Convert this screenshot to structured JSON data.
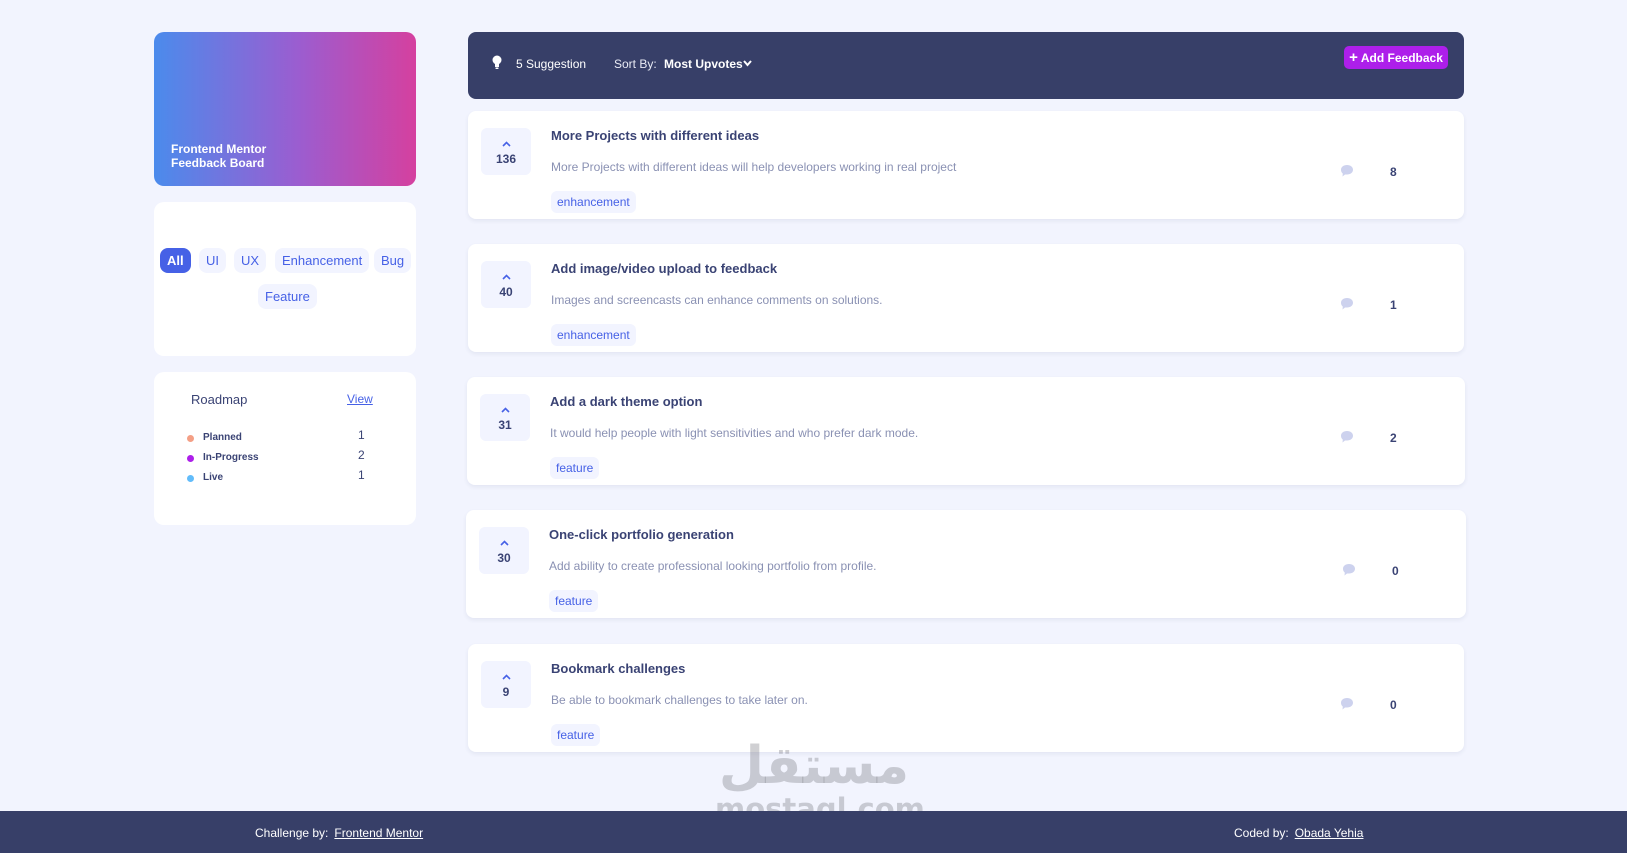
{
  "brand": {
    "line1": "Frontend Mentor",
    "line2": "Feedback Board"
  },
  "filters": [
    "All",
    "UI",
    "UX",
    "Enhancement",
    "Bug",
    "Feature"
  ],
  "roadmap": {
    "title": "Roadmap",
    "view_label": "View",
    "items": [
      {
        "label": "Planned",
        "count": "1",
        "color": "#f49f85"
      },
      {
        "label": "In-Progress",
        "count": "2",
        "color": "#ad1fea"
      },
      {
        "label": "Live",
        "count": "1",
        "color": "#62bcfa"
      }
    ]
  },
  "toolbar": {
    "suggestions": "5 Suggestion",
    "sort_label": "Sort By:",
    "sort_value": "Most Upvotes",
    "add_label": "Add Feedback"
  },
  "feedback": [
    {
      "votes": "136",
      "title": "More Projects with different ideas",
      "description": "More Projects with different ideas will help developers working in real project",
      "tag": "enhancement",
      "comments": "8"
    },
    {
      "votes": "40",
      "title": "Add image/video upload to feedback",
      "description": "Images and screencasts can enhance comments on solutions.",
      "tag": "enhancement",
      "comments": "1"
    },
    {
      "votes": "31",
      "title": "Add a dark theme option",
      "description": "It would help people with light sensitivities and who prefer dark mode.",
      "tag": "feature",
      "comments": "2"
    },
    {
      "votes": "30",
      "title": "One-click portfolio generation",
      "description": "Add ability to create professional looking portfolio from profile.",
      "tag": "feature",
      "comments": "0"
    },
    {
      "votes": "9",
      "title": "Bookmark challenges",
      "description": "Be able to bookmark challenges to take later on.",
      "tag": "feature",
      "comments": "0"
    }
  ],
  "footer": {
    "challenge_label": "Challenge by:",
    "challenge_link": "Frontend Mentor",
    "coded_label": "Coded by:",
    "coded_link": "Obada Yehia"
  },
  "watermark": {
    "arabic": "مستقل",
    "latin": "mostaql.com"
  },
  "colors": {
    "accent": "#4661e6",
    "purple": "#ad1fea",
    "navy": "#373f68",
    "background": "#f2f4fe"
  }
}
